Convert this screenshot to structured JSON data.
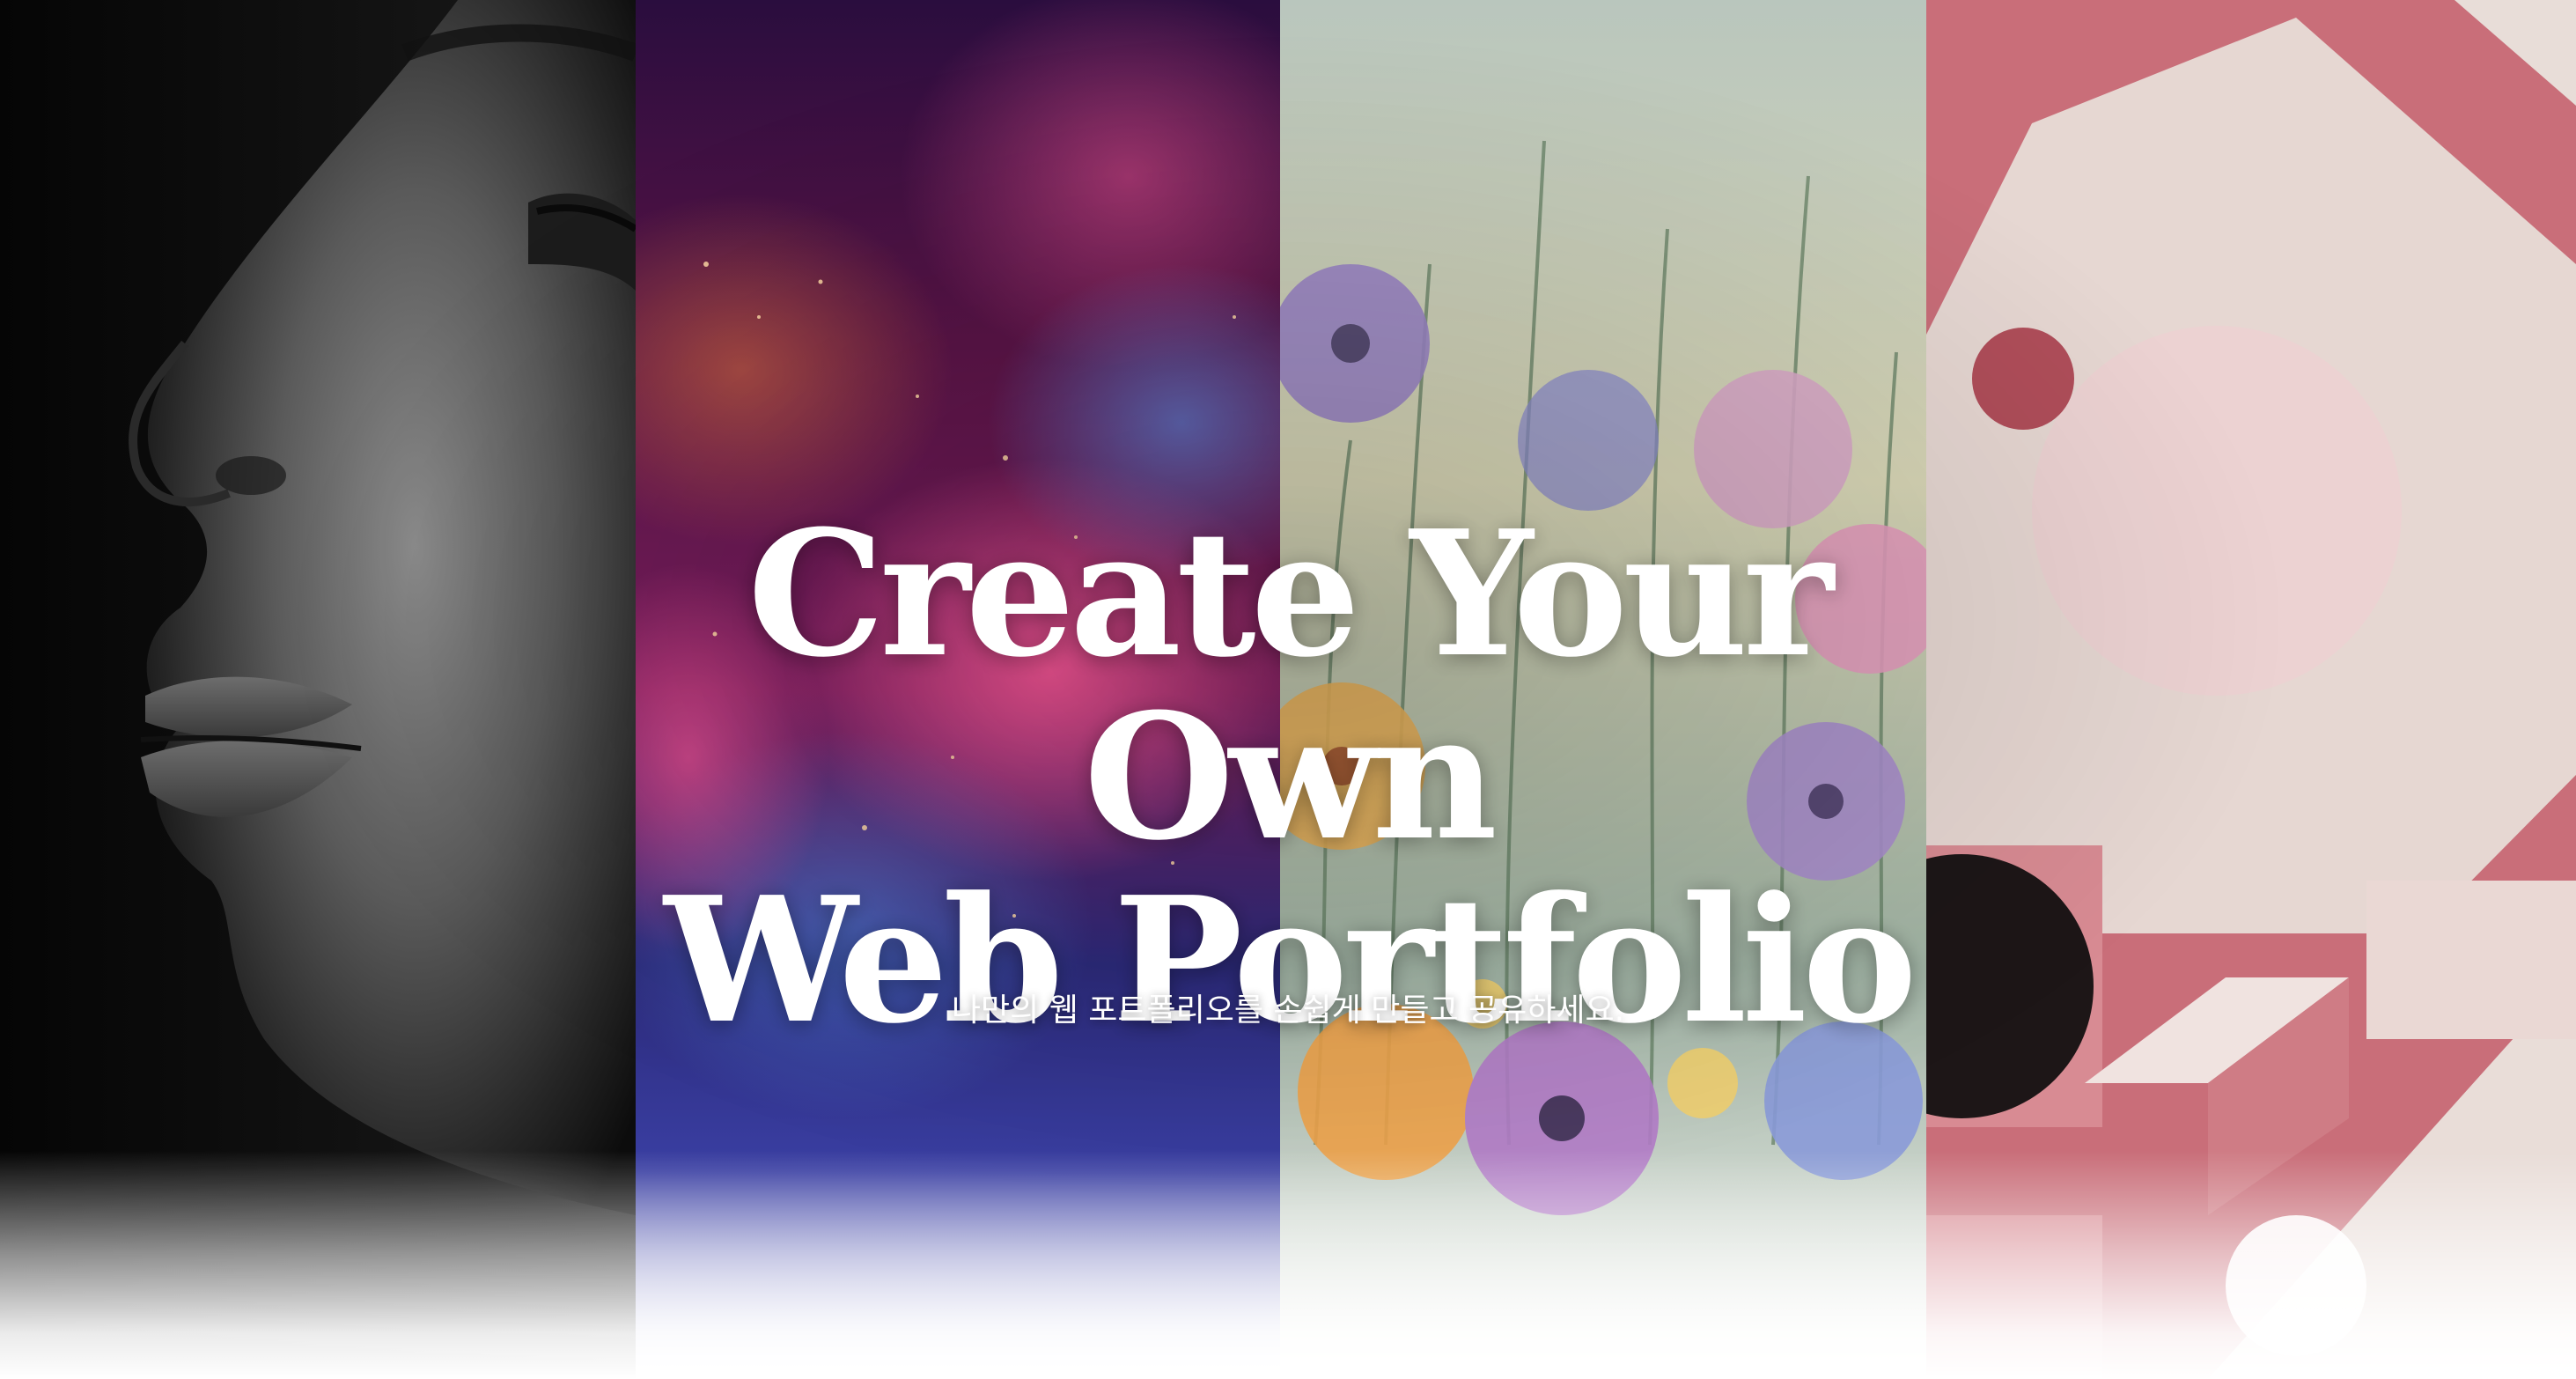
{
  "hero": {
    "headline_lines": [
      "Create Your",
      "Own",
      "Web Portfolio"
    ],
    "subtitle": "나만의 웹 포트폴리오를 손쉽게 만들고 공유하세요."
  },
  "panels": [
    {
      "image": "black-and-white-portrait-closeup"
    },
    {
      "image": "cosmic-nebula-purple-blue"
    },
    {
      "image": "watercolor-wildflowers"
    },
    {
      "image": "pink-geometric-abstract"
    }
  ],
  "colors": {
    "headline": "#ffffff",
    "subtitle": "#ffffff",
    "fade": "#ffffff"
  }
}
